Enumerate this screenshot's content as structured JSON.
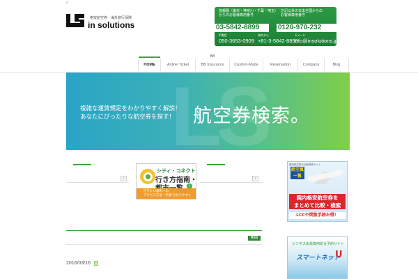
{
  "header": {
    "top_mark": "c",
    "logo_tagline": "格安航空券・海外旅行保険",
    "logo_name": "in solutions"
  },
  "contact": {
    "left_label_1": "首都圏（東京・神奈川・千葉・埼玉）",
    "left_label_2": "からのお客様専用番号",
    "left_phone": "03-5842-8899",
    "right_label_1": "左記以外の日本全国からの",
    "right_label_2": "お客様専用番号",
    "right_phone": "0120-970-232",
    "ip_label": "IP電話",
    "ip_value": "050-3653-0909",
    "intl_label": "海外から",
    "intl_value": "+81-3-5842-8899",
    "email_label": "Eメール",
    "email_value": "info@insolutions.jp"
  },
  "nav": {
    "items": [
      {
        "label": "HOME",
        "top": ""
      },
      {
        "label": "Airline Ticket",
        "top": ""
      },
      {
        "label": "BB Insurance",
        "top": "BB"
      },
      {
        "label": "Custom-Made",
        "top": ""
      },
      {
        "label": "Reservation",
        "top": ""
      },
      {
        "label": "Company",
        "top": ""
      },
      {
        "label": "Blog",
        "top": ""
      }
    ]
  },
  "banner": {
    "sub_line_1": "複雑な運賃規定をわかりやすく解説！",
    "sub_line_2": "あなたにぴったりな航空券を探す！",
    "title": "航空券検索。"
  },
  "columns": {
    "btn": "›"
  },
  "ad_city": {
    "line1": "シティ・コネクト",
    "line2": "行き方指南・",
    "line3": "都市一覧",
    "arrow": "›",
    "foot_1": "行きたい都市への",
    "foot_2": "アクセス方法・手順 分かりやすく"
  },
  "ad1": {
    "top": "格安航空券の比較検索サイト",
    "badge_1": "航空真",
    "badge_2": "一覧",
    "red_1": "国内格安航空券を",
    "red_2": "まとめて比較・検索",
    "foot": "LCCや閑散手続お得！"
  },
  "ad2": {
    "top": "ビジネス出張専用総合予約サイト",
    "mid": "スマートネット",
    "u": "U"
  },
  "news": {
    "rss": "RSS",
    "date": "2016/03/16"
  },
  "colors": {
    "brand_green": "#1d7f35",
    "accent_green": "#3aa53a"
  }
}
